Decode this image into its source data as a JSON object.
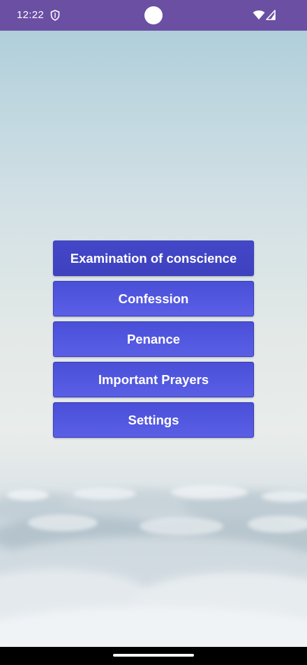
{
  "status_bar": {
    "time": "12:22",
    "background": "#6a4fa3",
    "icons": [
      "shield-icon",
      "camera-cutout",
      "wifi-icon",
      "signal-icon"
    ]
  },
  "menu": {
    "items": [
      {
        "label": "Examination of conscience"
      },
      {
        "label": "Confession"
      },
      {
        "label": "Penance"
      },
      {
        "label": "Important Prayers"
      },
      {
        "label": "Settings"
      }
    ],
    "button_color": "#4f54dd"
  },
  "background": {
    "description_colors": [
      "#a9cbd8",
      "#e9ecea"
    ]
  },
  "nav_bar": {
    "background": "#000000"
  }
}
